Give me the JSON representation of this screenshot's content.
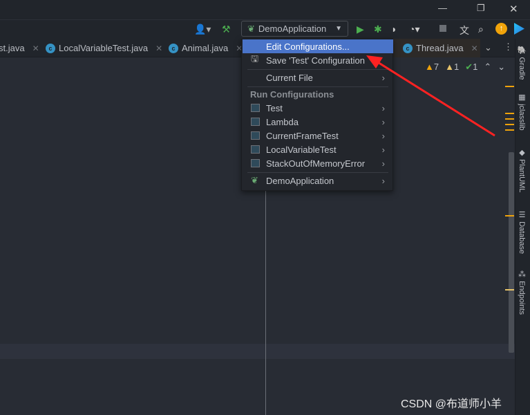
{
  "window": {
    "minimize": "—",
    "restore": "❐",
    "close": "✕"
  },
  "toolbar": {
    "run_config": "DemoApplication",
    "colors": {
      "run": "#4caf50",
      "accent": "#f0a30a"
    }
  },
  "tabs": [
    {
      "label": "st.java"
    },
    {
      "label": "LocalVariableTest.java"
    },
    {
      "label": "Animal.java"
    },
    {
      "label": "Thread.java"
    }
  ],
  "inspections": {
    "warnings": "7",
    "weak_warnings": "1",
    "typos": "1"
  },
  "menu": {
    "edit": "Edit Configurations...",
    "save": "Save 'Test' Configuration",
    "current_file": "Current File",
    "header": "Run Configurations",
    "configs": [
      "Test",
      "Lambda",
      "CurrentFrameTest",
      "LocalVariableTest",
      "StackOutOfMemoryError"
    ],
    "demo": "DemoApplication",
    "highlight": "#4a74c9"
  },
  "right_tools": [
    "Gradle",
    "jclasslib",
    "PlantUML",
    "Database",
    "Endpoints"
  ],
  "watermark": "CSDN @布道师小羊"
}
